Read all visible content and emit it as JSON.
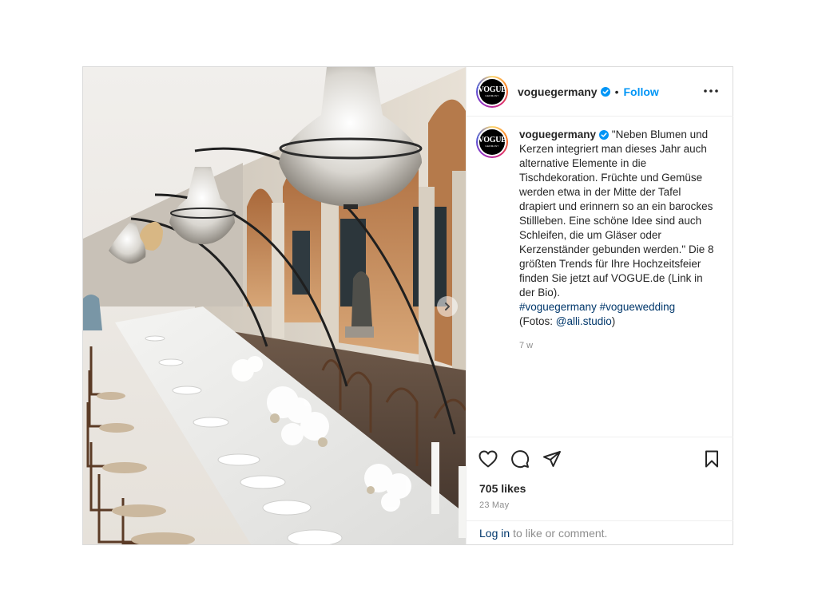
{
  "post": {
    "account": {
      "username": "voguegermany",
      "avatar_logo": "VOGUE",
      "avatar_sub": "GERMANY",
      "verified": true
    },
    "header": {
      "separator": "•",
      "follow_label": "Follow"
    },
    "caption": {
      "text": "\"Neben Blumen und Kerzen integriert man dieses Jahr auch alternative Elemente in die Tischdekoration. Früchte und Gemüse werden etwa in der Mitte der Tafel drapiert und erinnern so an ein barockes Stillleben. Eine schöne Idee sind auch Schleifen, die um Gläser oder Kerzenständer gebunden werden.\" Die 8 größten Trends für Ihre Hochzeitsfeier finden Sie jetzt auf VOGUE.de (Link in der Bio).",
      "hashtag_1": "#voguegermany",
      "hashtag_2": "#voguewedding",
      "credit_prefix": "(Fotos: ",
      "credit_handle": "@alli.studio",
      "credit_suffix": ")",
      "time_ago": "7 w"
    },
    "stats": {
      "likes": "705 likes",
      "date": "23 May"
    },
    "footer": {
      "login_label": "Log in",
      "login_suffix": "to like or comment."
    },
    "icons": {
      "like": "heart-icon",
      "comment": "comment-icon",
      "share": "share-icon",
      "save": "bookmark-icon",
      "more": "more-icon",
      "next": "chevron-right-icon",
      "verified": "verified-badge-icon"
    },
    "colors": {
      "follow": "#0095f6",
      "link": "#00376b",
      "verified": "#0095f6",
      "muted": "#8e8e8e"
    }
  }
}
